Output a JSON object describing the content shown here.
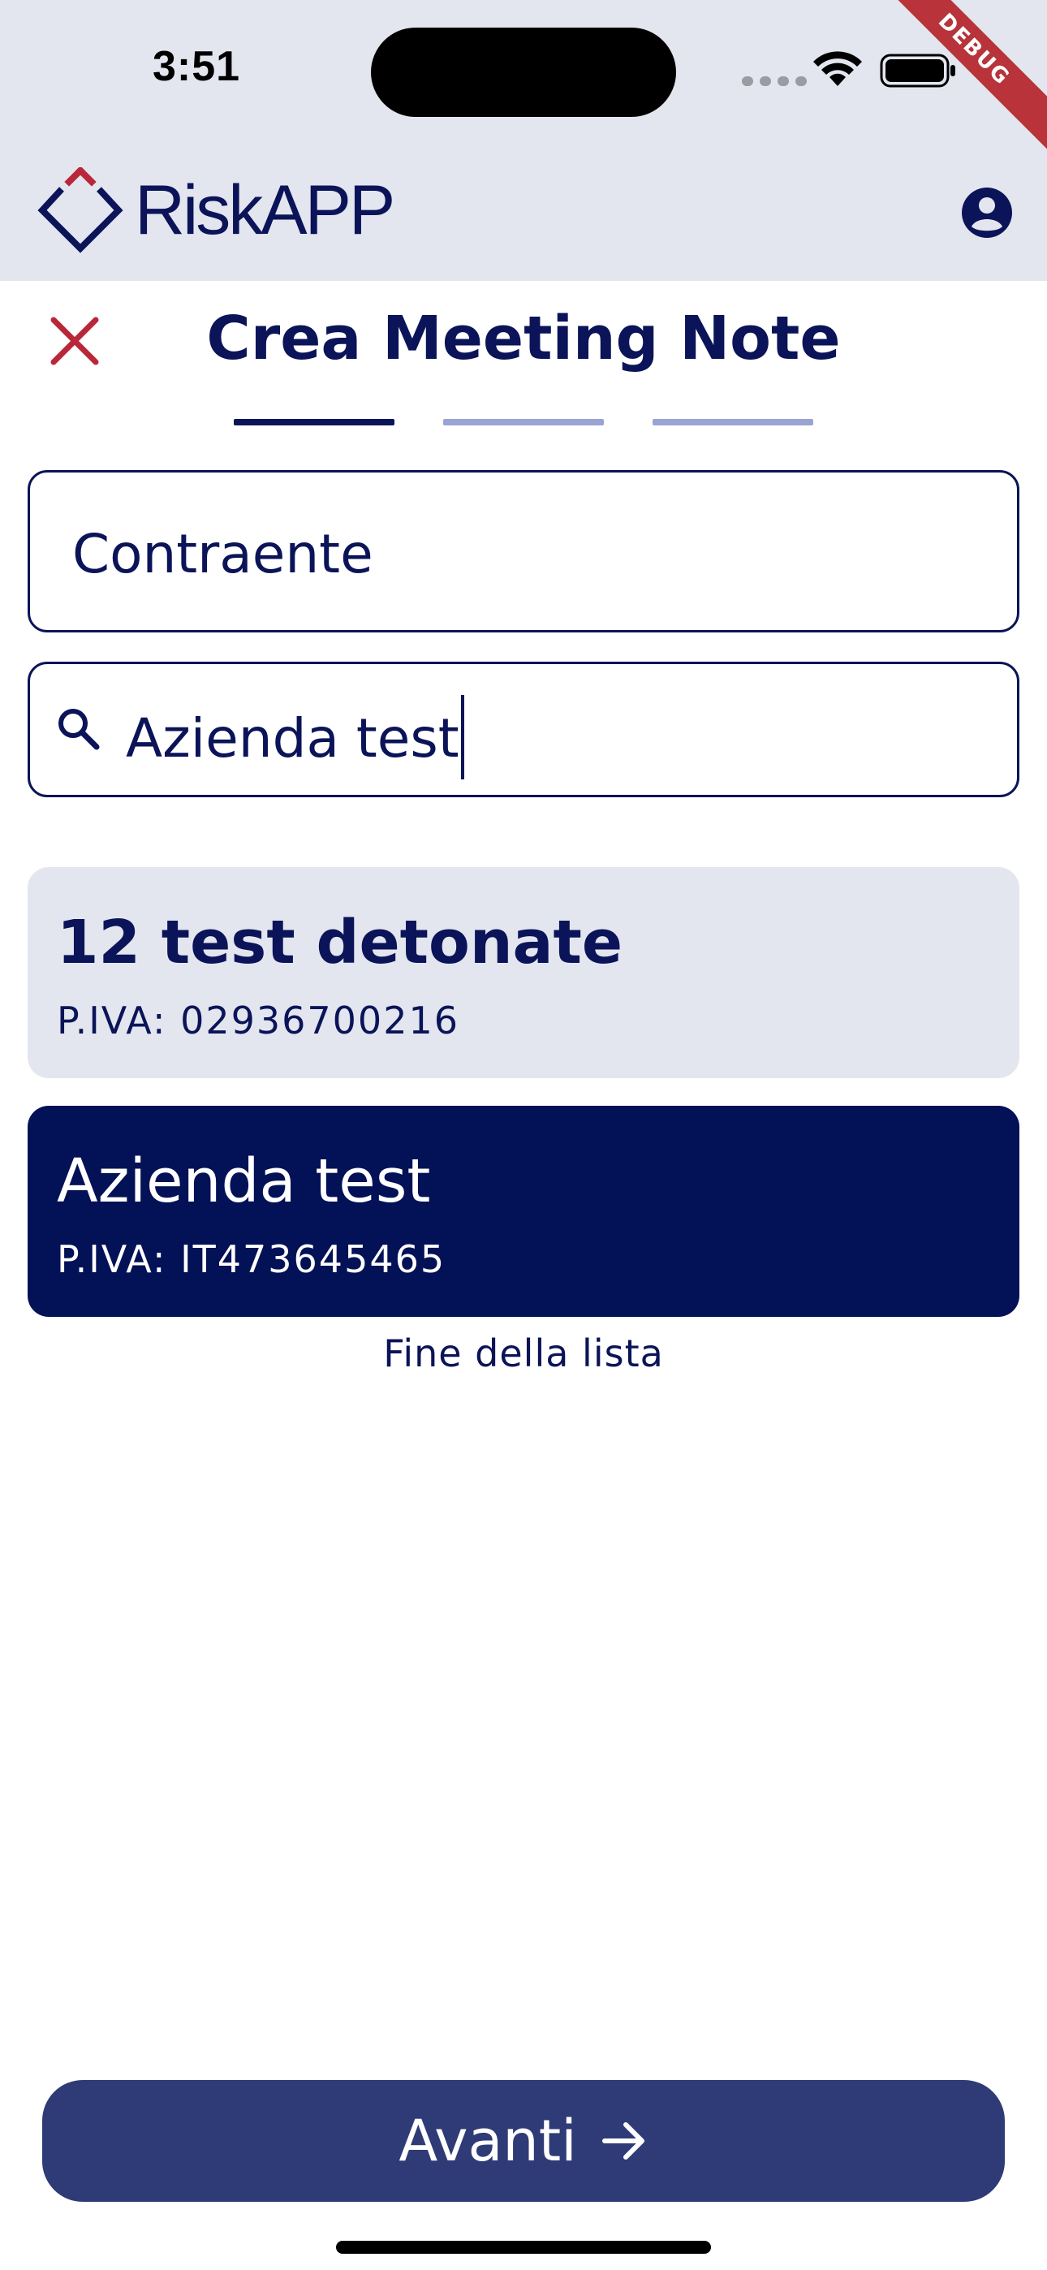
{
  "status_bar": {
    "time": "3:51",
    "icons": [
      "signal-dots-icon",
      "wifi-icon",
      "battery-icon"
    ]
  },
  "debug_banner": "DEBUG",
  "app_bar": {
    "logo_text": "RiskAPP",
    "logo_icon": "diamond-logo-icon",
    "profile_icon": "account-circle-icon"
  },
  "header": {
    "title": "Crea Meeting Note",
    "close_icon": "close-icon",
    "steps_total": 3,
    "current_step": 1
  },
  "form": {
    "contraente_value": "Contraente",
    "search_value": "Azienda test",
    "search_icon": "search-icon"
  },
  "results": [
    {
      "name": "12 test detonate",
      "piva": "P.IVA: 02936700216",
      "selected": false
    },
    {
      "name": "Azienda test",
      "piva": "P.IVA: IT473645465",
      "selected": true
    }
  ],
  "end_of_list": "Fine della lista",
  "footer": {
    "next_label": "Avanti",
    "next_icon": "arrow-right-icon"
  },
  "colors": {
    "primary": "#0b1458",
    "selected_card": "#031156",
    "card_bg": "#e3e6ef",
    "button_bg": "#2f3b76",
    "close_red": "#b8283a",
    "step_inactive": "#9aa4d2",
    "debug_red": "#b8333a"
  }
}
